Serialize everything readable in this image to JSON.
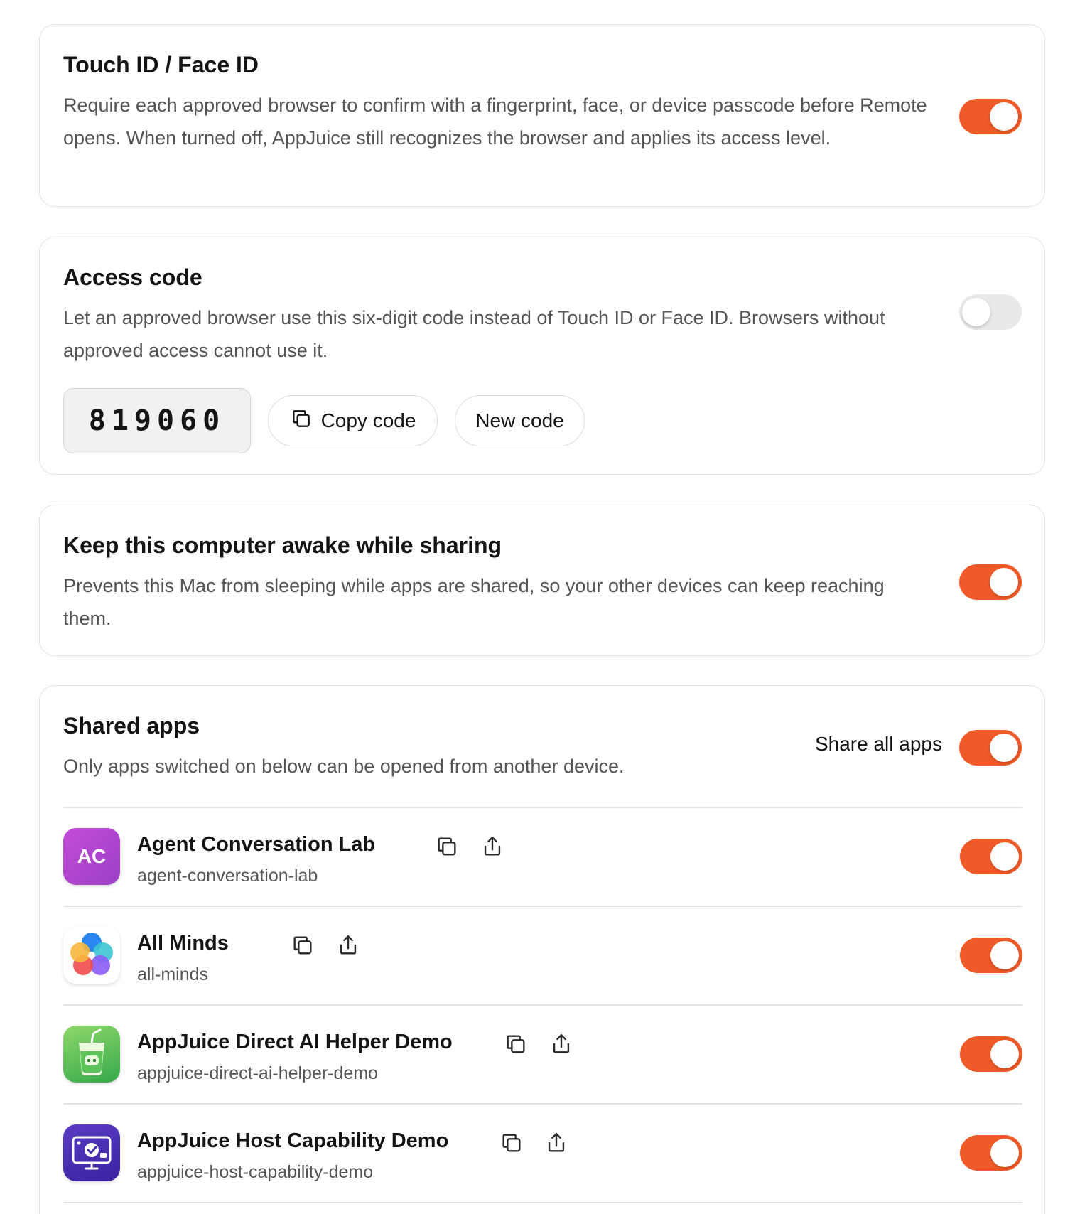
{
  "touch_id": {
    "title": "Touch ID / Face ID",
    "description": "Require each approved browser to confirm with a fingerprint, face, or device passcode before Remote opens. When turned off, AppJuice still recognizes the browser and applies its access level.",
    "enabled": true
  },
  "access_code": {
    "title": "Access code",
    "description": "Let an approved browser use this six-digit code instead of Touch ID or Face ID. Browsers without approved access cannot use it.",
    "enabled": false,
    "code": "819060",
    "copy_label": "Copy code",
    "new_label": "New code",
    "copy_icon": "copy-icon"
  },
  "keep_awake": {
    "title": "Keep this computer awake while sharing",
    "description": "Prevents this Mac from sleeping while apps are shared, so your other devices can keep reaching them.",
    "enabled": true
  },
  "shared_apps": {
    "title": "Shared apps",
    "description": "Only apps switched on below can be opened from another device.",
    "share_all_label": "Share all apps",
    "share_all_enabled": true,
    "apps": [
      {
        "name": "Agent Conversation Lab",
        "slug": "agent-conversation-lab",
        "icon": "ac-monogram-icon",
        "icon_text": "AC",
        "enabled": true
      },
      {
        "name": "All Minds",
        "slug": "all-minds",
        "icon": "flower-petals-icon",
        "enabled": true
      },
      {
        "name": "AppJuice Direct AI Helper Demo",
        "slug": "appjuice-direct-ai-helper-demo",
        "icon": "juice-cup-robot-icon",
        "enabled": true
      },
      {
        "name": "AppJuice Host Capability Demo",
        "slug": "appjuice-host-capability-demo",
        "icon": "host-monitor-check-icon",
        "enabled": true
      }
    ]
  },
  "colors": {
    "accent": "#f05a28",
    "toggle_off": "#e9e9eb",
    "border": "#e3e3e6",
    "text_primary": "#141414",
    "text_secondary": "#555559"
  }
}
